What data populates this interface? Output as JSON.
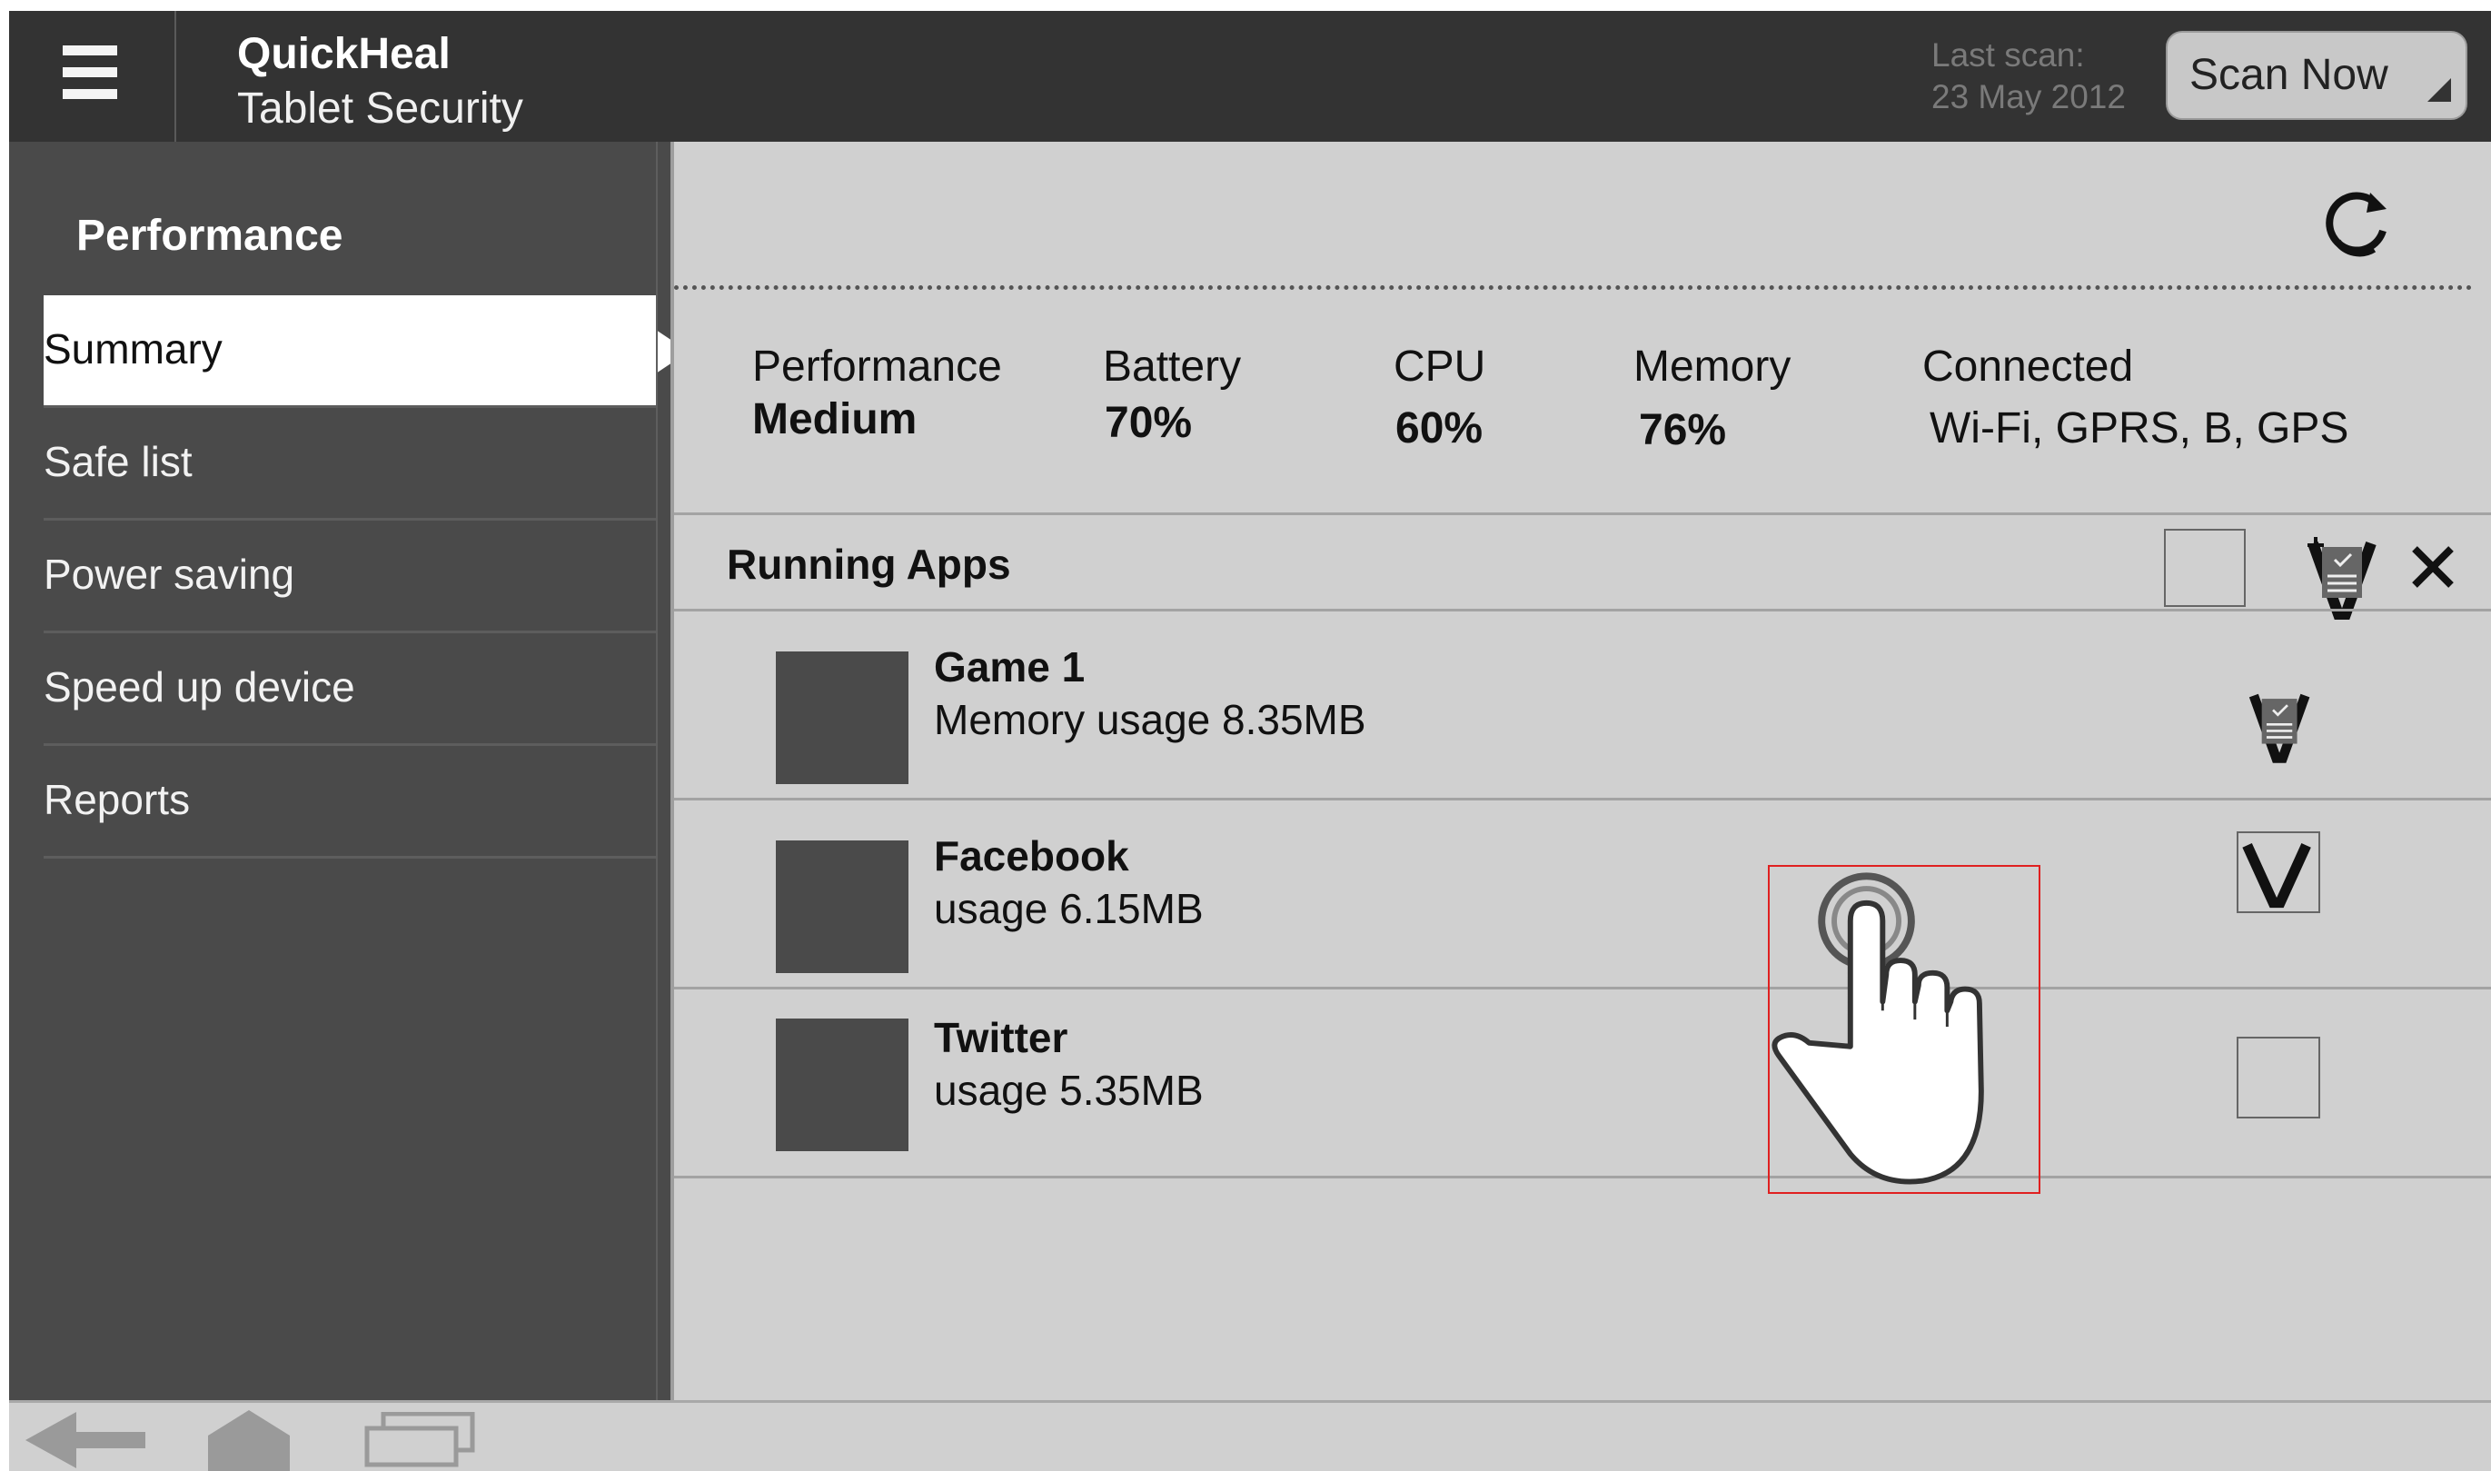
{
  "header": {
    "app_name": "QuickHeal",
    "app_subtitle": "Tablet Security",
    "last_scan_label": "Last scan:",
    "last_scan_date": "23 May 2012",
    "scan_button": "Scan Now"
  },
  "sidebar": {
    "title": "Performance",
    "items": [
      {
        "label": "Summary",
        "active": true
      },
      {
        "label": "Safe list"
      },
      {
        "label": "Power saving"
      },
      {
        "label": "Speed up device"
      },
      {
        "label": "Reports"
      }
    ]
  },
  "stats": {
    "performance": {
      "label": "Performance",
      "value": "Medium"
    },
    "battery": {
      "label": "Battery",
      "value": "70%"
    },
    "cpu": {
      "label": "CPU",
      "value": "60%"
    },
    "memory": {
      "label": "Memory",
      "value": "76%"
    },
    "connected": {
      "label": "Connected",
      "value": "Wi-Fi, GPRS, B, GPS"
    }
  },
  "running_apps": {
    "title": "Running Apps",
    "apps": [
      {
        "name": "Game 1",
        "usage": "Memory usage 8.35MB",
        "state": "checklist-icon"
      },
      {
        "name": "Facebook",
        "usage": "usage 6.15MB",
        "state": "checked"
      },
      {
        "name": "Twitter",
        "usage": "usage 5.35MB",
        "state": "unchecked"
      }
    ]
  },
  "colors": {
    "header_bg": "#333333",
    "sidebar_bg": "#4a4a4a",
    "panel_bg": "#d0d0d0",
    "touch_annotation": "#e02020"
  }
}
